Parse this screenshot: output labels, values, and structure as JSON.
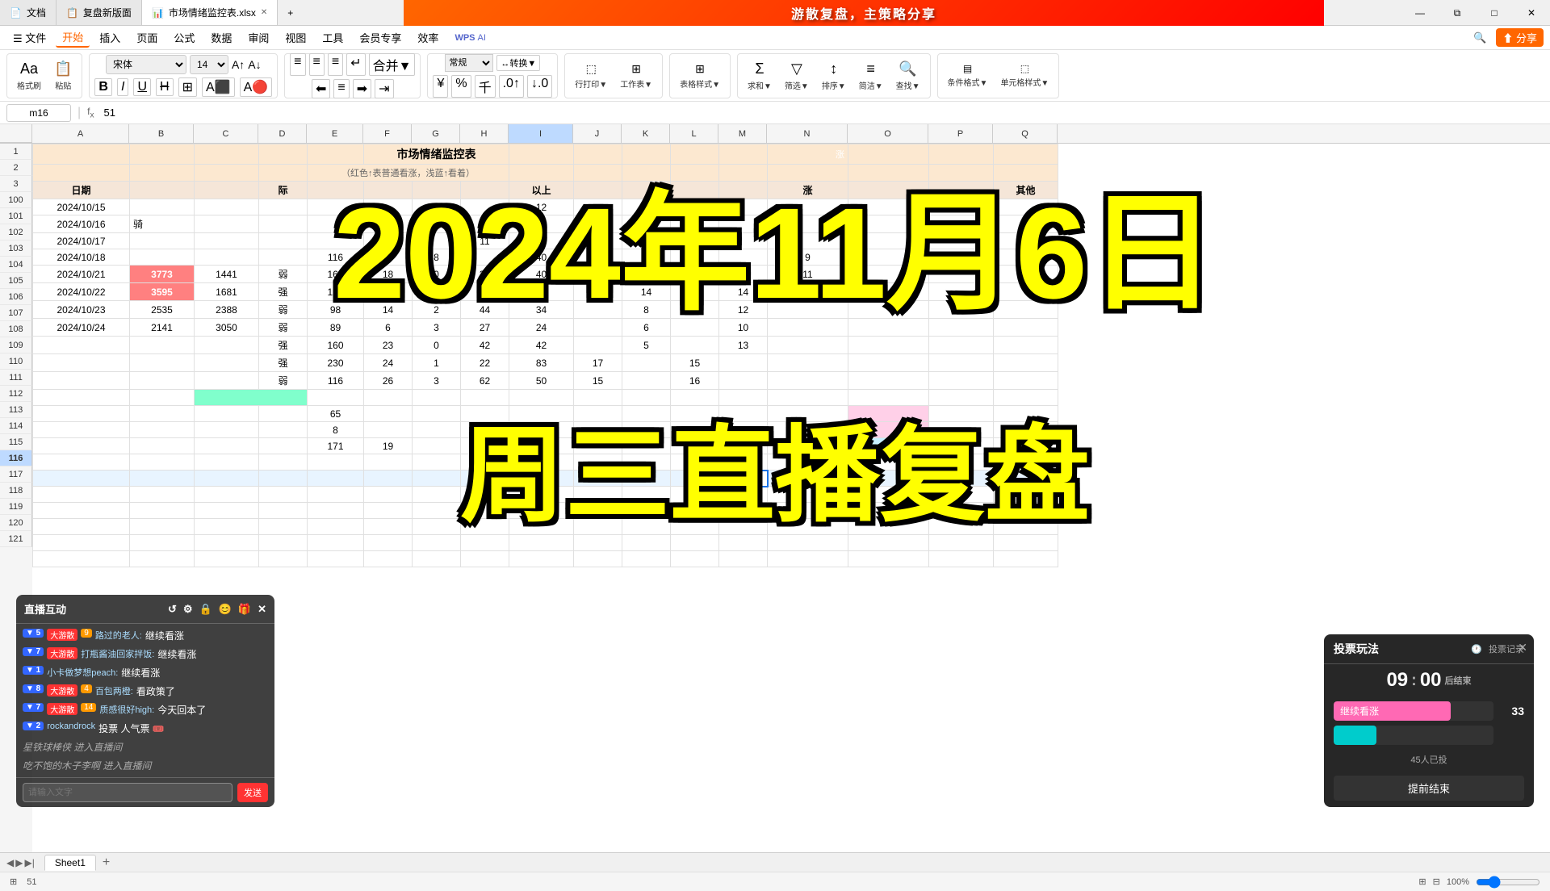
{
  "app": {
    "title": "WPS 表格",
    "tabs": [
      {
        "label": "文档",
        "icon": "📄",
        "active": false,
        "closable": false
      },
      {
        "label": "复盘新版面",
        "icon": "📋",
        "active": false,
        "closable": false
      },
      {
        "label": "市场情绪监控表.xlsx",
        "icon": "📊",
        "active": true,
        "closable": true
      }
    ]
  },
  "banner": {
    "text": "游散复盘，主策略分享"
  },
  "menu": {
    "items": [
      "文件",
      "开始",
      "插入",
      "页面",
      "公式",
      "数据",
      "审阅",
      "视图",
      "工具",
      "会员专享",
      "效率",
      "WPS AI"
    ],
    "active": "开始"
  },
  "formula_bar": {
    "cell_ref": "m16",
    "formula": "51"
  },
  "spreadsheet": {
    "title": "市场情绪监控表",
    "subtitle": "（红色↑表普通看涨，浅蓝↑看着）",
    "col_headers": [
      "A",
      "B",
      "C",
      "D",
      "E",
      "F",
      "G",
      "H",
      "I",
      "J",
      "K",
      "L",
      "M",
      "N",
      "O",
      "P",
      "Q"
    ],
    "row3_headers": [
      "日期",
      "",
      "",
      "际",
      "",
      "",
      "",
      "",
      "以上",
      "",
      "",
      "",
      "",
      "涨",
      "",
      "",
      "其他"
    ],
    "rows": [
      {
        "num": 100,
        "cells": [
          "2024/10/15",
          "",
          "",
          "",
          "",
          "",
          "8",
          "",
          "12",
          "",
          "",
          "",
          "",
          "",
          "",
          "",
          ""
        ]
      },
      {
        "num": 101,
        "cells": [
          "2024/10/16",
          "骑",
          "",
          "",
          "",
          "",
          "14",
          "",
          "12",
          "",
          "",
          "",
          "",
          "",
          "",
          "",
          ""
        ]
      },
      {
        "num": 102,
        "cells": [
          "2024/10/17",
          "",
          "",
          "",
          "",
          "",
          "",
          "11",
          "",
          "",
          "",
          "",
          "",
          "",
          "",
          "",
          ""
        ]
      },
      {
        "num": 103,
        "cells": [
          "2024/10/18",
          "",
          "",
          "",
          "116",
          "",
          "8",
          "",
          "40",
          "",
          "20",
          "",
          "",
          "9",
          "",
          "",
          ""
        ]
      },
      {
        "num": 104,
        "cells": [
          "2024/10/21",
          "3773",
          "1441",
          "弱",
          "166",
          "18",
          "0",
          "39",
          "40",
          "",
          "",
          "9",
          "",
          "11",
          "",
          "",
          ""
        ]
      },
      {
        "num": 105,
        "cells": [
          "2024/10/22",
          "3595",
          "1681",
          "强",
          "107",
          "0",
          "0",
          "50",
          "39",
          "17",
          "14",
          "",
          "14",
          "",
          "",
          "",
          ""
        ]
      },
      {
        "num": 106,
        "cells": [
          "2024/10/23",
          "2535",
          "2388",
          "弱",
          "98",
          "14",
          "2",
          "44",
          "34",
          "",
          "8",
          "",
          "12",
          "",
          "",
          "",
          ""
        ]
      },
      {
        "num": 107,
        "cells": [
          "2024/10/24",
          "2141",
          "3050",
          "弱",
          "89",
          "6",
          "3",
          "27",
          "24",
          "",
          "6",
          "",
          "10",
          "",
          "",
          "",
          ""
        ]
      },
      {
        "num": 108,
        "cells": [
          "",
          "",
          "",
          "强",
          "160",
          "23",
          "0",
          "42",
          "42",
          "",
          "5",
          "",
          "13",
          "",
          "",
          "",
          ""
        ]
      },
      {
        "num": 109,
        "cells": [
          "",
          "",
          "",
          "强",
          "230",
          "24",
          "1",
          "22",
          "83",
          "17",
          "",
          "15",
          "",
          "",
          "",
          "",
          ""
        ]
      },
      {
        "num": 110,
        "cells": [
          "",
          "",
          "",
          "弱",
          "116",
          "26",
          "3",
          "62",
          "50",
          "15",
          "",
          "16",
          "",
          "",
          "",
          "",
          ""
        ]
      },
      {
        "num": 111,
        "cells": [
          "",
          "",
          "",
          "",
          "",
          "",
          "",
          "",
          "",
          "",
          "",
          "",
          "",
          "",
          "",
          "",
          ""
        ]
      },
      {
        "num": 112,
        "cells": [
          "",
          "",
          "",
          "",
          "65",
          "",
          "",
          "",
          "",
          "",
          "",
          "",
          "",
          "",
          "",
          "",
          ""
        ]
      },
      {
        "num": 113,
        "cells": [
          "",
          "",
          "",
          "",
          "8",
          "",
          "",
          "",
          "",
          "",
          "",
          "",
          "",
          "",
          "",
          "",
          ""
        ]
      },
      {
        "num": 114,
        "cells": [
          "",
          "",
          "",
          "",
          "171",
          "19",
          "",
          "",
          "",
          "",
          "",
          "",
          "",
          "",
          "",
          "",
          ""
        ]
      },
      {
        "num": 115,
        "cells": [
          "",
          "",
          "",
          "",
          "",
          "",
          "",
          "",
          "",
          "",
          "",
          "",
          "",
          "",
          "",
          "",
          ""
        ]
      },
      {
        "num": 116,
        "cells": [
          "",
          "",
          "",
          "",
          "",
          "",
          "",
          "",
          "",
          "",
          "",
          "",
          "",
          "",
          "",
          "",
          ""
        ]
      },
      {
        "num": 117,
        "cells": [
          "",
          "",
          "",
          "",
          "",
          "",
          "",
          "",
          "",
          "",
          "",
          "",
          "",
          "",
          "",
          "",
          ""
        ]
      },
      {
        "num": 118,
        "cells": [
          "",
          "",
          "",
          "",
          "",
          "",
          "",
          "",
          "",
          "",
          "",
          "",
          "",
          "",
          "",
          "",
          ""
        ]
      },
      {
        "num": 119,
        "cells": [
          "",
          "",
          "",
          "",
          "",
          "",
          "",
          "",
          "",
          "",
          "",
          "",
          "",
          "",
          "",
          "",
          ""
        ]
      },
      {
        "num": 120,
        "cells": [
          "",
          "",
          "",
          "",
          "",
          "",
          "",
          "",
          "",
          "",
          "",
          "",
          "",
          "",
          "",
          "",
          ""
        ]
      },
      {
        "num": 121,
        "cells": [
          "",
          "",
          "",
          "",
          "",
          "",
          "",
          "",
          "",
          "",
          "",
          "",
          "",
          "",
          "",
          "",
          ""
        ]
      }
    ],
    "active_cell": "m16"
  },
  "overlay": {
    "date_text": "2024年11月6日",
    "subtitle_text": "周三直播复盘"
  },
  "live_chat": {
    "title": "直播互动",
    "messages": [
      {
        "level": "5",
        "level_color": "blue",
        "badge": "大游散",
        "badge_num": "9",
        "username": "路过的老人",
        "text": "继续看涨"
      },
      {
        "level": "7",
        "level_color": "blue",
        "badge": "大游散",
        "badge_num": "",
        "username": "打瓶酱油回家拌饭",
        "text": "继续看涨"
      },
      {
        "level": "1",
        "level_color": "blue",
        "badge": "",
        "badge_num": "",
        "username": "小卡做梦想peach",
        "text": "继续看涨"
      },
      {
        "level": "8",
        "level_color": "blue",
        "badge": "大游散",
        "badge_num": "4",
        "username": "百包两橙",
        "text": "看政策了"
      },
      {
        "level": "7",
        "level_color": "blue",
        "badge": "大游散",
        "badge_num": "14",
        "username": "质感很好high",
        "text": "今天回本了"
      },
      {
        "level": "2",
        "level_color": "blue",
        "badge": "",
        "badge_num": "",
        "username": "rockandrock",
        "text": "投票 人气票 🎟️"
      }
    ],
    "special_messages": [
      {
        "text": "星铁球棒侠 进入直播间"
      },
      {
        "text": "吃不饱的木子李啊 进入直播间"
      }
    ],
    "input_placeholder": "请输入文字",
    "send_label": "发送"
  },
  "vote_panel": {
    "title": "投票玩法",
    "links": [
      "投票记录"
    ],
    "timer": {
      "minutes": "09",
      "seconds": "00",
      "label": "后结束"
    },
    "options": [
      {
        "label": "继续看涨",
        "fill_pct": 73,
        "count": "33",
        "color": "pink"
      },
      {
        "label": "",
        "fill_pct": 27,
        "count": "",
        "color": "teal"
      }
    ],
    "participants": "45人已投",
    "submit_label": "提前结束"
  },
  "status_bar": {
    "cell_value": "51",
    "zoom": "100%"
  }
}
